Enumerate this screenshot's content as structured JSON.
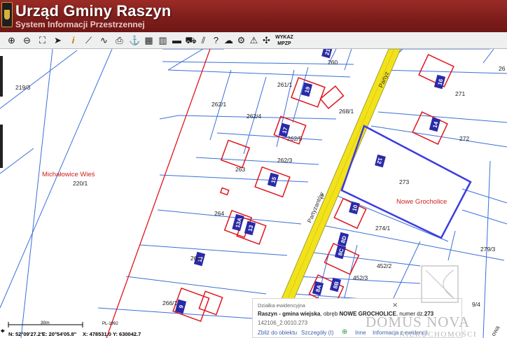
{
  "header": {
    "title": "Urząd Gminy Raszyn",
    "subtitle": "System Informacji Przestrzennej"
  },
  "toolbar": {
    "wykaz_line1": "WYKAZ",
    "wykaz_line2": "MPZP",
    "tools": [
      {
        "name": "zoom-in-icon",
        "glyph": "⊕"
      },
      {
        "name": "zoom-out-icon",
        "glyph": "⊖"
      },
      {
        "name": "zoom-extent-icon",
        "glyph": "⛶"
      },
      {
        "name": "pointer-icon",
        "glyph": "➤"
      },
      {
        "name": "info-icon",
        "glyph": "i"
      },
      {
        "name": "measure-distance-icon",
        "glyph": "⟋"
      },
      {
        "name": "measure-path-icon",
        "glyph": "∿"
      },
      {
        "name": "print-icon",
        "glyph": "⎙"
      },
      {
        "name": "anchor-icon",
        "glyph": "⚓"
      },
      {
        "name": "select-area-icon",
        "glyph": "▦"
      },
      {
        "name": "layers-icon",
        "glyph": "▥"
      },
      {
        "name": "map-view-icon",
        "glyph": "▬"
      },
      {
        "name": "car-icon",
        "glyph": "⛟"
      },
      {
        "name": "hatch-icon",
        "glyph": "⫽"
      },
      {
        "name": "help-icon",
        "glyph": "?"
      },
      {
        "name": "cloud-icon",
        "glyph": "☁"
      },
      {
        "name": "settings-icon",
        "glyph": "⚙"
      },
      {
        "name": "warning-icon",
        "glyph": "⚠"
      },
      {
        "name": "tools-icon",
        "glyph": "✣"
      }
    ]
  },
  "map": {
    "parcels": [
      "219/3",
      "220/1",
      "262/1",
      "262/4",
      "262/5",
      "262/3",
      "263",
      "264",
      "261/1",
      "260",
      "268/1",
      "271",
      "272",
      "273",
      "274/1",
      "279/3",
      "452/2",
      "452/3",
      "266/1",
      "262",
      "26",
      "9/4",
      "2"
    ],
    "places": [
      "Michałowice Wieś",
      "Nowe Grocholice"
    ],
    "street": "Partyzantów",
    "street_partial": "Partyz",
    "street_partial_right": "owa",
    "house_numbers": [
      "19",
      "17",
      "15",
      "13A",
      "13",
      "11",
      "9",
      "12",
      "10",
      "8D",
      "8C",
      "8B",
      "16",
      "14",
      "21",
      "8A"
    ],
    "colors": {
      "parcel_line": "#3a6fd8",
      "building": "#e0141d",
      "selected": "#3c3ce0",
      "street": "#f2e21a",
      "label": "#cc1f1a"
    }
  },
  "status": {
    "scale_label": "30m",
    "crs": "PL-1992",
    "latitude": "N: 52°09'27.2\"",
    "longitude": "E: 20°54'05.8\"",
    "x": "X: 478531.0",
    "y": "Y: 630042.7"
  },
  "popup": {
    "heading": "Działka ewidencyjna",
    "line1_a": "Raszyn - gmina wiejska",
    "line1_b": ", obręb",
    "line1_c": "NOWE GROCHOLICE",
    "line1_d": ", numer dz.",
    "line1_e": "273",
    "line2": "142106_2.0010.273",
    "link_zoom": "Zbliż do obiektu",
    "link_details": "Szczegóły (I)",
    "link_other": "Inne",
    "link_info": "Informacja z ewidencji"
  },
  "watermark": {
    "name": "DOMUS NOVA",
    "sub": "NIERUCHOMOŚCI"
  }
}
